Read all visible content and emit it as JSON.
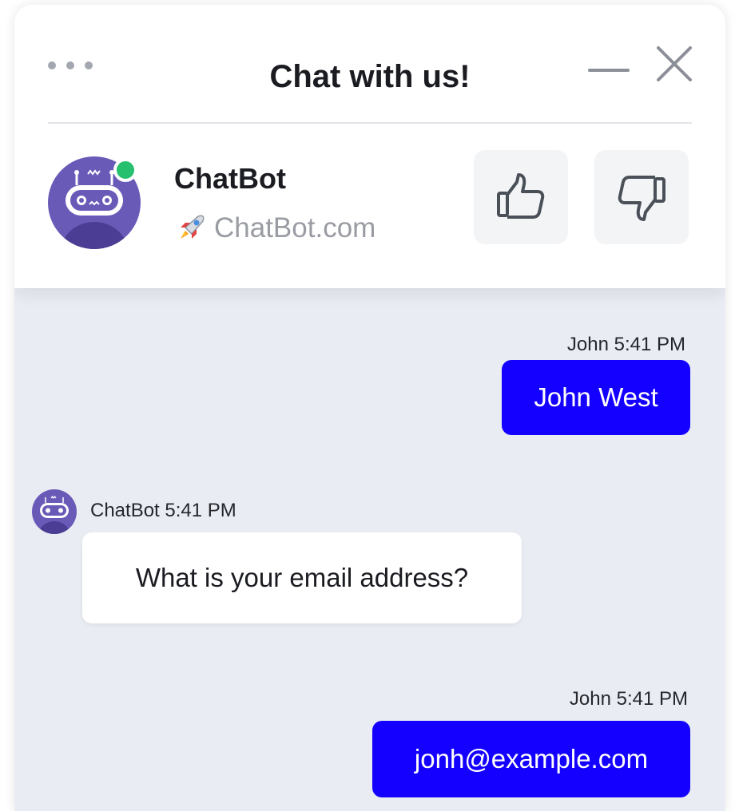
{
  "header": {
    "title": "Chat with us!",
    "menu_icon": "ellipsis-icon",
    "minimize_icon": "minimize-icon",
    "close_icon": "close-icon"
  },
  "agent": {
    "name": "ChatBot",
    "site": "ChatBot.com",
    "site_icon": "rocket-icon",
    "status": "online",
    "status_color": "#26c06e",
    "avatar_color": "#6a5ab8"
  },
  "rating": {
    "thumbs_up_icon": "thumbs-up-icon",
    "thumbs_down_icon": "thumbs-down-icon"
  },
  "colors": {
    "user_bubble": "#1400ff",
    "chat_background": "#e9ecf2"
  },
  "messages": [
    {
      "sender": "John",
      "time": "5:41 PM",
      "meta": "John 5:41 PM",
      "text": "John West",
      "from": "user"
    },
    {
      "sender": "ChatBot",
      "time": "5:41 PM",
      "meta": "ChatBot 5:41 PM",
      "text": "What is your email address?",
      "from": "bot"
    },
    {
      "sender": "John",
      "time": "5:41 PM",
      "meta": "John 5:41 PM",
      "text": "jonh@example.com",
      "from": "user"
    }
  ]
}
